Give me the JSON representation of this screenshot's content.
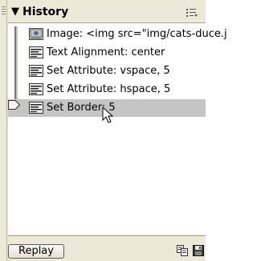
{
  "panel": {
    "title": "History",
    "steps": [
      {
        "label": "Image: <img src=\"img/cats-duce.j",
        "icon": "image-step-icon",
        "selected": false
      },
      {
        "label": "Text Alignment: center",
        "icon": "text-step-icon",
        "selected": false
      },
      {
        "label": "Set Attribute: vspace, 5",
        "icon": "text-step-icon",
        "selected": false
      },
      {
        "label": "Set Attribute: hspace, 5",
        "icon": "text-step-icon",
        "selected": false
      },
      {
        "label": "Set Border: 5",
        "icon": "text-step-icon",
        "selected": true
      }
    ],
    "replay_label": "Replay"
  },
  "colors": {
    "panel_bg": "#ece9d8",
    "selected_row": "#c5c5c5"
  }
}
